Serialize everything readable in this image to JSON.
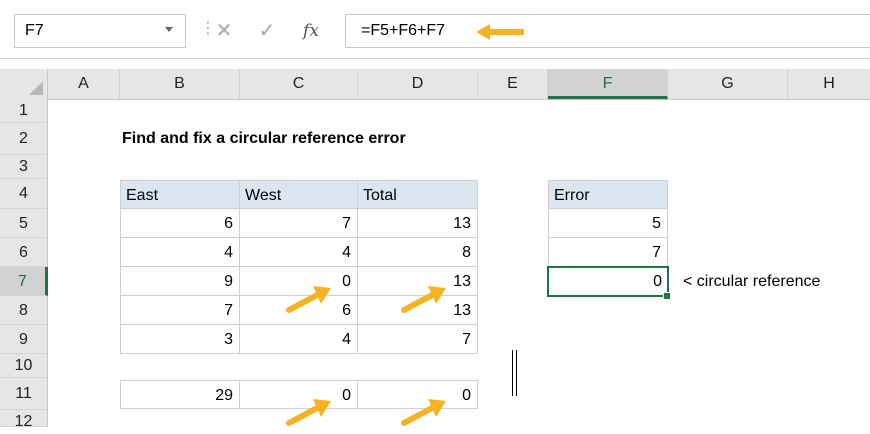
{
  "formula_bar": {
    "name_box": "F7",
    "cancel_icon": "x-icon",
    "enter_icon": "check-icon",
    "function_label": "fx",
    "formula": "=F5+F6+F7"
  },
  "columns": [
    "A",
    "B",
    "C",
    "D",
    "E",
    "F",
    "G",
    "H"
  ],
  "rows": [
    "1",
    "2",
    "3",
    "4",
    "5",
    "6",
    "7",
    "8",
    "9",
    "10",
    "11",
    "12"
  ],
  "active_cell": {
    "column": "F",
    "row": "7"
  },
  "title": "Find and fix a circular reference error",
  "table": {
    "headers": [
      "East",
      "West",
      "Total"
    ],
    "data": [
      [
        "6",
        "7",
        "13"
      ],
      [
        "4",
        "4",
        "8"
      ],
      [
        "9",
        "0",
        "13"
      ],
      [
        "7",
        "6",
        "13"
      ],
      [
        "3",
        "4",
        "7"
      ]
    ],
    "totals": [
      "29",
      "0",
      "0"
    ]
  },
  "error_table": {
    "header": "Error",
    "values": [
      "5",
      "7",
      "0"
    ]
  },
  "note": "< circular reference",
  "colors": {
    "accent_green": "#217346",
    "header_fill": "#dce6f1",
    "arrow_orange": "#f5b324"
  }
}
